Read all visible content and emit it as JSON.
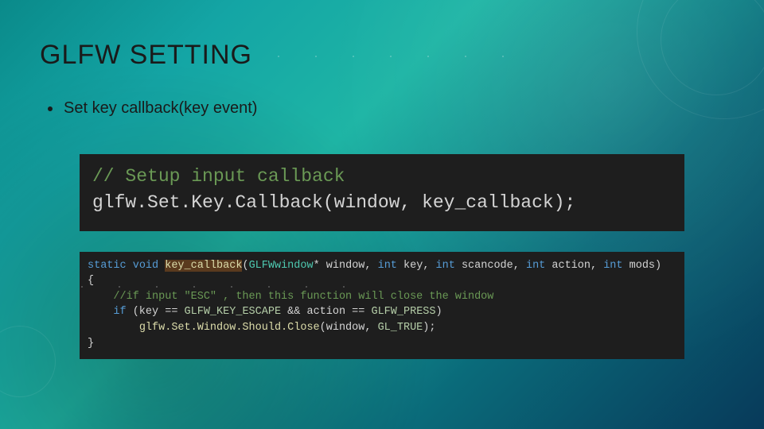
{
  "slide": {
    "title": "GLFW SETTING",
    "bullet": "Set key callback(key event)"
  },
  "code_block_1": {
    "comment": "// Setup input callback",
    "line": "glfw.Set.Key.Callback(window, key_callback);"
  },
  "code_block_2": {
    "sig": {
      "kw_static": "static",
      "kw_void": "void",
      "fn_name": "key_callback",
      "params_open": "(",
      "type_win": "GLFWwindow",
      "star": "*",
      "p_window": " window, ",
      "t_int1": "int",
      "p_key": " key, ",
      "t_int2": "int",
      "p_scan": " scancode, ",
      "t_int3": "int",
      "p_action": " action, ",
      "t_int4": "int",
      "p_mods": " mods)",
      "brace_open": "{"
    },
    "body": {
      "comment": "//if input \"ESC\" , then this function will close the window",
      "if_kw": "if",
      "if_open": " (key == ",
      "esc": "GLFW_KEY_ESCAPE",
      "and": " && action == ",
      "press": "GLFW_PRESS",
      "if_close": ")",
      "call_fn": "glfw.Set.Window.Should.Close",
      "call_args_open": "(window, ",
      "gl_true": "GL_TRUE",
      "call_args_close": ");"
    },
    "brace_close": "}"
  }
}
